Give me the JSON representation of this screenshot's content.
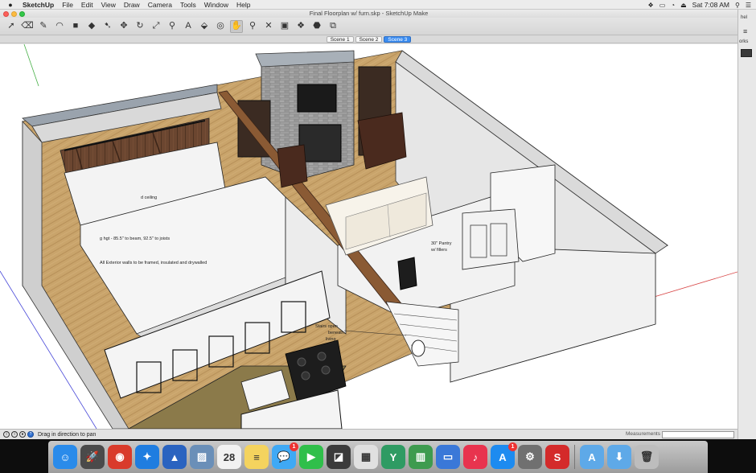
{
  "menubar": {
    "app_name": "SketchUp",
    "items": [
      "File",
      "Edit",
      "View",
      "Draw",
      "Camera",
      "Tools",
      "Window",
      "Help"
    ],
    "clock": "Sat 7:08 AM"
  },
  "window": {
    "title": "Final Floorplan w/ furn.skp - SketchUp Make"
  },
  "scenes": {
    "tabs": [
      {
        "label": "Scene 1",
        "active": false
      },
      {
        "label": "Scene 2",
        "active": false
      },
      {
        "label": "Scene 3",
        "active": true
      }
    ]
  },
  "toolbar": {
    "tools": [
      {
        "name": "select-tool-icon",
        "glyph": "➚",
        "selected": false
      },
      {
        "name": "eraser-tool-icon",
        "glyph": "⌫",
        "selected": false
      },
      {
        "name": "pencil-tool-icon",
        "glyph": "✎",
        "selected": false
      },
      {
        "name": "arc-tool-icon",
        "glyph": "◠",
        "selected": false
      },
      {
        "name": "shape-tool-icon",
        "glyph": "■",
        "selected": false
      },
      {
        "name": "push-pull-tool-icon",
        "glyph": "◆",
        "selected": false
      },
      {
        "name": "follow-me-tool-icon",
        "glyph": "➷",
        "selected": false
      },
      {
        "name": "move-tool-icon",
        "glyph": "✥",
        "selected": false
      },
      {
        "name": "rotate-tool-icon",
        "glyph": "↻",
        "selected": false
      },
      {
        "name": "scale-tool-icon",
        "glyph": "⤢",
        "selected": false
      },
      {
        "name": "tape-measure-tool-icon",
        "glyph": "⚲",
        "selected": false
      },
      {
        "name": "text-tool-icon",
        "glyph": "A",
        "selected": false
      },
      {
        "name": "paint-bucket-tool-icon",
        "glyph": "⬙",
        "selected": false
      },
      {
        "name": "orbit-tool-icon",
        "glyph": "◎",
        "selected": false
      },
      {
        "name": "pan-tool-icon",
        "glyph": "✋",
        "selected": true
      },
      {
        "name": "zoom-tool-icon",
        "glyph": "⚲",
        "selected": false
      },
      {
        "name": "zoom-extents-tool-icon",
        "glyph": "✕",
        "selected": false
      },
      {
        "name": "warehouse-icon",
        "glyph": "▣",
        "selected": false
      },
      {
        "name": "components-icon",
        "glyph": "❖",
        "selected": false
      },
      {
        "name": "extension-warehouse-icon",
        "glyph": "⬣",
        "selected": false
      },
      {
        "name": "send-to-layout-icon",
        "glyph": "⧉",
        "selected": false
      }
    ]
  },
  "model": {
    "labels": {
      "ceiling_height": "d ceiling",
      "beam_height": "g hgt - 85.5\" to beam, 92.5\" to joists",
      "exterior_walls": "All Exterior walls to be framed, insulated and drywalled",
      "pantry_line1": "30\" Pantry",
      "pantry_line2": "w/ fillers",
      "stairs_line1": "Stairs open",
      "stairs_line2": "beneath",
      "stairs_line3": "living"
    }
  },
  "status": {
    "hint": "Drag in direction to pan",
    "measurements_label": "Measurements",
    "measurements_value": ""
  },
  "sidestrip": {
    "label1": "hel",
    "label2": "orks"
  },
  "dock": {
    "items": [
      {
        "name": "finder-icon",
        "glyph": "☺",
        "color": "#2a8bea",
        "badge": ""
      },
      {
        "name": "launchpad-icon",
        "glyph": "🚀",
        "color": "#4a4a4a",
        "badge": ""
      },
      {
        "name": "chrome-icon",
        "glyph": "◉",
        "color": "#d93b2b",
        "badge": ""
      },
      {
        "name": "safari-icon",
        "glyph": "✦",
        "color": "#1f7de0",
        "badge": ""
      },
      {
        "name": "affinity-icon",
        "glyph": "▲",
        "color": "#2a63c0",
        "badge": ""
      },
      {
        "name": "preview-icon",
        "glyph": "▨",
        "color": "#6a8fb8",
        "badge": ""
      },
      {
        "name": "calendar-icon",
        "glyph": "28",
        "color": "#f2f2f2",
        "badge": ""
      },
      {
        "name": "notes-icon",
        "glyph": "≡",
        "color": "#f4d35e",
        "badge": ""
      },
      {
        "name": "messages-icon",
        "glyph": "💬",
        "color": "#3fa9f5",
        "badge": "1"
      },
      {
        "name": "facetime-icon",
        "glyph": "▶",
        "color": "#2fbf4a",
        "badge": ""
      },
      {
        "name": "photo-booth-icon",
        "glyph": "◪",
        "color": "#3b3b3b",
        "badge": ""
      },
      {
        "name": "keynote-icon",
        "glyph": "▦",
        "color": "#e0e0e0",
        "badge": ""
      },
      {
        "name": "money-app-icon",
        "glyph": "Y",
        "color": "#2f9b63",
        "badge": ""
      },
      {
        "name": "numbers-icon",
        "glyph": "▥",
        "color": "#3e9b4f",
        "badge": ""
      },
      {
        "name": "presentation-icon",
        "glyph": "▭",
        "color": "#3a78d8",
        "badge": ""
      },
      {
        "name": "itunes-icon",
        "glyph": "♪",
        "color": "#e8334e",
        "badge": ""
      },
      {
        "name": "app-store-icon",
        "glyph": "A",
        "color": "#1d8bf0",
        "badge": "1"
      },
      {
        "name": "system-preferences-icon",
        "glyph": "⚙",
        "color": "#707070",
        "badge": ""
      },
      {
        "name": "sketchup-icon",
        "glyph": "S",
        "color": "#d42a2a",
        "badge": ""
      },
      {
        "name": "applications-folder-icon",
        "glyph": "A",
        "color": "#5ea9e8",
        "badge": ""
      },
      {
        "name": "downloads-folder-icon",
        "glyph": "⬇",
        "color": "#5ea9e8",
        "badge": ""
      },
      {
        "name": "trash-icon",
        "glyph": "🗑",
        "color": "#bdbdbd",
        "badge": ""
      }
    ]
  }
}
